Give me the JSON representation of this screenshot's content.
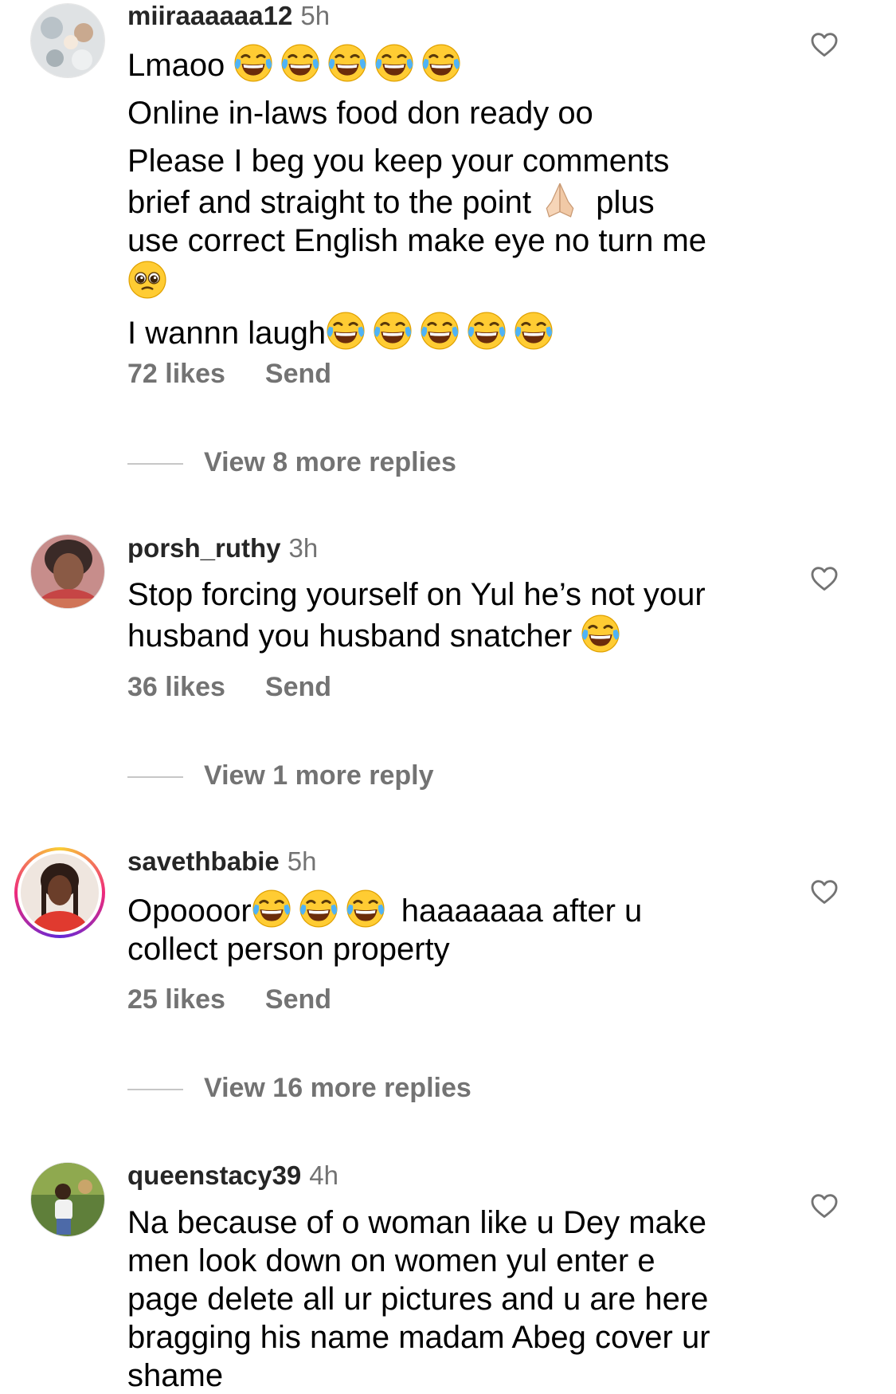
{
  "comments": [
    {
      "username": "miiraaaaaa12",
      "time": "5h",
      "lines": [
        "Lmaoo 😂😂😂😂😂",
        "Online in-laws food don ready oo",
        "Please I beg you keep your comments",
        "brief and straight to the point 🙏🏻 plus",
        "use correct English make eye no turn me",
        "🥹",
        "I wannn laugh😂😂😂😂😂"
      ],
      "likes": "72 likes",
      "send": "Send",
      "view_replies": "View 8 more replies"
    },
    {
      "username": "porsh_ruthy",
      "time": "3h",
      "lines": [
        "Stop forcing yourself on Yul he’s not your",
        "husband you husband snatcher 😂"
      ],
      "likes": "36 likes",
      "send": "Send",
      "view_replies": "View 1 more reply"
    },
    {
      "username": "savethbabie",
      "time": "5h",
      "lines": [
        "Opoooor😂😂😂 haaaaaaa after u",
        "collect person property"
      ],
      "likes": "25 likes",
      "send": "Send",
      "view_replies": "View 16 more replies"
    },
    {
      "username": "queenstacy39",
      "time": "4h",
      "lines": [
        "Na because of o woman like u Dey make",
        "men look down on women yul enter e",
        "page delete all ur pictures and u are here",
        "bragging his name madam Abeg cover ur",
        "shame"
      ]
    }
  ],
  "icons": {
    "heart": "heart-outline-icon",
    "laugh": "face-with-tears-of-joy",
    "pleading": "pleading-face",
    "pray": "folded-hands"
  },
  "colors": {
    "muted": "#737373",
    "username": "#262626",
    "story_ring": [
      "#f9ce34",
      "#ee2a7b",
      "#6228d7"
    ]
  }
}
